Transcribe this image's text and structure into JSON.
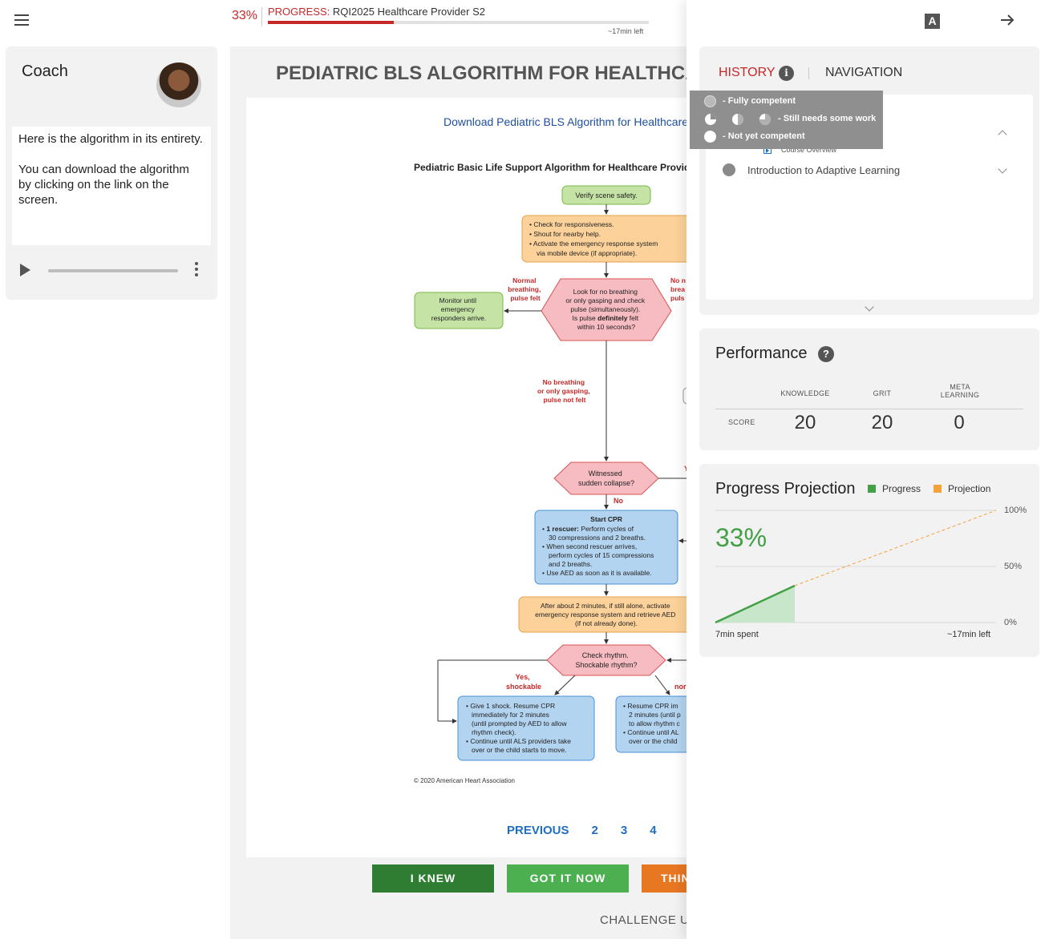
{
  "topbar": {
    "progress_pct": "33%",
    "progress_prefix": "PROGRESS:",
    "progress_course": "RQI2025 Healthcare Provider S2",
    "progress_fraction": 0.33,
    "time_left": "~17min left"
  },
  "coach": {
    "title": "Coach",
    "message_1": "Here is the algorithm in its entirety.",
    "message_2": "You can download the algorithm by clicking on the link on the screen."
  },
  "main": {
    "title": "PEDIATRIC BLS ALGORITHM FOR HEALTHCARE PROVIDERS",
    "download_link": "Download Pediatric BLS Algorithm for Healthcare Providers",
    "algo_title": "Pediatric Basic Life Support Algorithm for Healthcare Providers",
    "copyright": "© 2020 American Heart Association",
    "flow": {
      "verify": "Verify scene safety.",
      "check1": "• Check for responsiveness.",
      "check2": "• Shout for nearby help.",
      "check3": "• Activate the emergency response system",
      "check4": "via mobile device (if appropriate).",
      "normal1": "Normal",
      "normal2": "breathing,",
      "normal3": "pulse felt",
      "noNormal1": "No n",
      "noNormal2": "brea",
      "noNormal3": "puls",
      "monitor1": "Monitor until",
      "monitor2": "emergency",
      "monitor3": "responders arrive.",
      "look1": "Look for no breathing",
      "look2": "or only gasping and check",
      "look3": "pulse (simultaneously).",
      "look4a": "Is pulse ",
      "look4b": "definitely",
      "look4c": " felt",
      "look5": "within 10 seconds?",
      "nob1": "No breathing",
      "nob2": "or only gasping,",
      "nob3": "pulse not felt",
      "wit1": "Witnessed",
      "wit2": "sudden collapse?",
      "yesSide": "Y",
      "no": "No",
      "cpr0": "Start CPR",
      "cpr1a": "• ",
      "cpr1b": "1 rescuer:",
      "cpr1c": " Perform cycles of",
      "cpr2": "30 compressions and 2 breaths.",
      "cpr3": "• When second rescuer arrives,",
      "cpr4": "perform cycles of 15 compressions",
      "cpr5": "and 2 breaths.",
      "cpr6": "• Use AED as soon as it is available.",
      "after1": "After about 2 minutes, if still alone, activate",
      "after2": "emergency response system and retrieve AED",
      "after3": "(if not already done).",
      "rhythm1": "Check rhythm.",
      "rhythm2": "Shockable rhythm?",
      "yesShock1": "Yes,",
      "yesShock2": "shockable",
      "nonShock": "nor",
      "shock1": "• Give 1 shock. Resume CPR",
      "shock2": "immediately for 2 minutes",
      "shock3": "(until prompted by AED to allow",
      "shock4": "rhythm check).",
      "shock5": "• Continue until ALS providers take",
      "shock6": "over or the child starts to move.",
      "resume1": "• Resume CPR im",
      "resume2": "2 minutes (until p",
      "resume3": "to allow rhythm c",
      "resume4": "• Continue until AL",
      "resume5": "over or the child"
    },
    "pager": [
      "PREVIOUS",
      "2",
      "3",
      "4"
    ],
    "buttons": {
      "knew": "I KNEW",
      "got": "GOT IT NOW",
      "think": "THIN"
    },
    "challenge": "CHALLENGE US"
  },
  "panel": {
    "font_icon": "A",
    "tabs": {
      "history": "HISTORY",
      "navigation": "NAVIGATION"
    },
    "history": {
      "course_overview": "Course Overview",
      "intro": "Introduction to Adaptive Learning"
    },
    "legend": {
      "fully": "- Fully competent",
      "needs": "- Still needs some work",
      "not_yet": "- Not yet competent"
    },
    "performance": {
      "title": "Performance",
      "headers": {
        "knowledge": "KNOWLEDGE",
        "grit": "GRIT",
        "meta1": "META",
        "meta2": "LEARNING"
      },
      "score_label": "SCORE",
      "scores": {
        "knowledge": "20",
        "grit": "20",
        "meta": "0"
      }
    },
    "projection": {
      "title": "Progress Projection",
      "legend_progress": "Progress",
      "legend_projection": "Projection",
      "pct": "33%",
      "ticks": {
        "t100": "100%",
        "t50": "50%",
        "t0": "0%"
      },
      "spent": "7min spent",
      "left": "~17min  left",
      "progress_color": "#43a047",
      "projection_color": "#f5a23a"
    }
  }
}
